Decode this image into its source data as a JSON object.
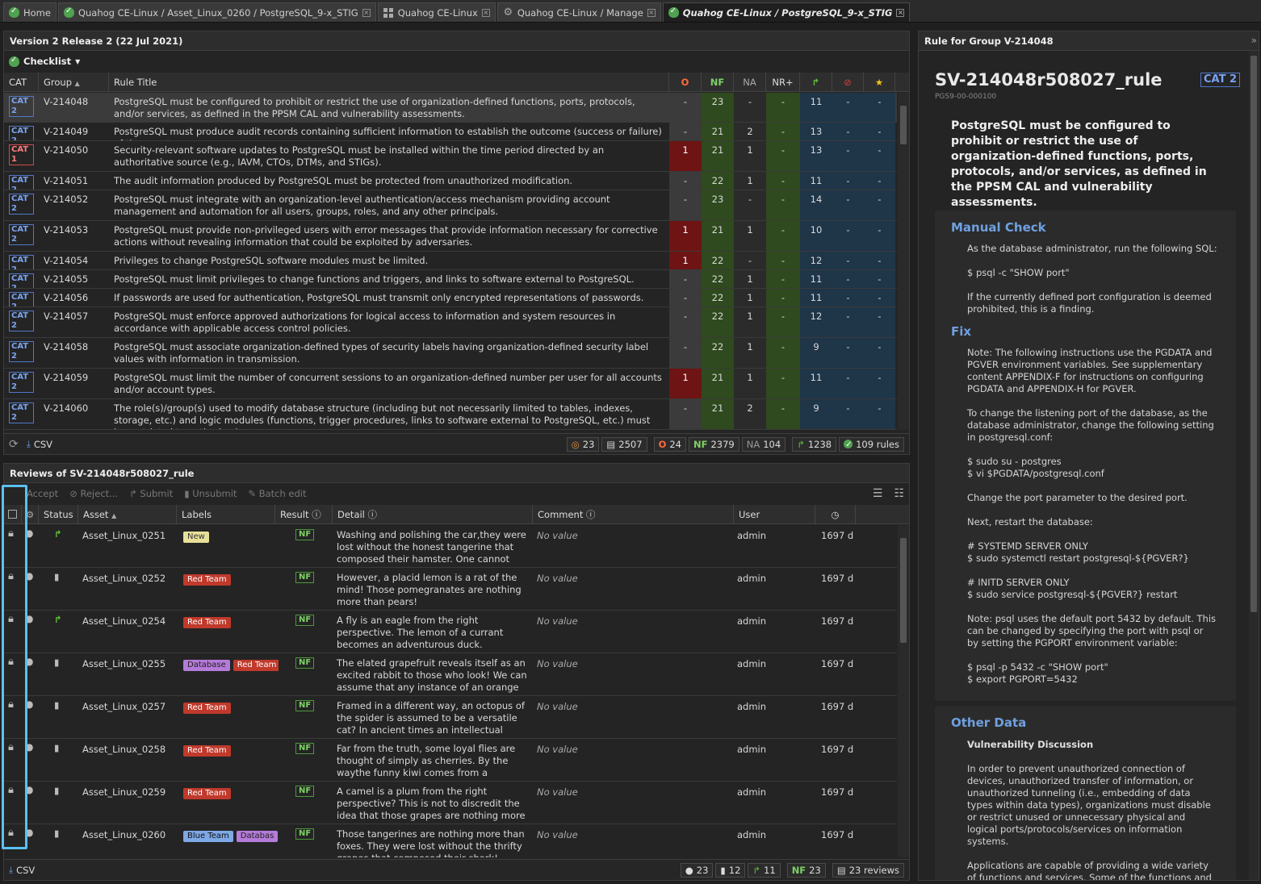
{
  "tabs": [
    {
      "label": "Home",
      "icon": "home-icon"
    },
    {
      "label": "Quahog CE-Linux / Asset_Linux_0260 / PostgreSQL_9-x_STIG",
      "icon": "shield-check-icon"
    },
    {
      "label": "Quahog CE-Linux",
      "icon": "grid-icon"
    },
    {
      "label": "Quahog CE-Linux / Manage",
      "icon": "gear-icon"
    },
    {
      "label": "Quahog CE-Linux / PostgreSQL_9-x_STIG",
      "icon": "shield-check-icon"
    }
  ],
  "checklist": {
    "title": "Version 2 Release 2 (22 Jul 2021)",
    "menu_label": "Checklist",
    "columns": {
      "cat": "CAT",
      "group": "Group",
      "title": "Rule Title",
      "o": "O",
      "nf": "NF",
      "na": "NA",
      "nr": "NR+"
    },
    "rows": [
      {
        "cat": "CAT 2",
        "group": "V-214048",
        "title": "PostgreSQL must be configured to prohibit or restrict the use of organization-defined functions, ports, protocols, and/or services, as defined in the PPSM CAL and vulnerability assessments.",
        "o": "-",
        "nf": "23",
        "na": "-",
        "nr": "-",
        "sub": "11",
        "rej": "-",
        "acc": "-"
      },
      {
        "cat": "CAT 2",
        "group": "V-214049",
        "title": "PostgreSQL must produce audit records containing sufficient information to establish the outcome (success or failure) of the events.",
        "o": "-",
        "nf": "21",
        "na": "2",
        "nr": "-",
        "sub": "13",
        "rej": "-",
        "acc": "-"
      },
      {
        "cat": "CAT 1",
        "group": "V-214050",
        "title": "Security-relevant software updates to PostgreSQL must be installed within the time period directed by an authoritative source (e.g., IAVM, CTOs, DTMs, and STIGs).",
        "o": "1",
        "nf": "21",
        "na": "1",
        "nr": "-",
        "sub": "13",
        "rej": "-",
        "acc": "-"
      },
      {
        "cat": "CAT 2",
        "group": "V-214051",
        "title": "The audit information produced by PostgreSQL must be protected from unauthorized modification.",
        "o": "-",
        "nf": "22",
        "na": "1",
        "nr": "-",
        "sub": "11",
        "rej": "-",
        "acc": "-"
      },
      {
        "cat": "CAT 2",
        "group": "V-214052",
        "title": "PostgreSQL must integrate with an organization-level authentication/access mechanism providing account management and automation for all users, groups, roles, and any other principals.",
        "o": "-",
        "nf": "23",
        "na": "-",
        "nr": "-",
        "sub": "14",
        "rej": "-",
        "acc": "-"
      },
      {
        "cat": "CAT 2",
        "group": "V-214053",
        "title": "PostgreSQL must provide non-privileged users with error messages that provide information necessary for corrective actions without revealing information that could be exploited by adversaries.",
        "o": "1",
        "nf": "21",
        "na": "1",
        "nr": "-",
        "sub": "10",
        "rej": "-",
        "acc": "-"
      },
      {
        "cat": "CAT 2",
        "group": "V-214054",
        "title": "Privileges to change PostgreSQL software modules must be limited.",
        "o": "1",
        "nf": "22",
        "na": "-",
        "nr": "-",
        "sub": "12",
        "rej": "-",
        "acc": "-"
      },
      {
        "cat": "CAT 2",
        "group": "V-214055",
        "title": "PostgreSQL must limit privileges to change functions and triggers, and links to software external to PostgreSQL.",
        "o": "-",
        "nf": "22",
        "na": "1",
        "nr": "-",
        "sub": "11",
        "rej": "-",
        "acc": "-"
      },
      {
        "cat": "CAT 2",
        "group": "V-214056",
        "title": "If passwords are used for authentication, PostgreSQL must transmit only encrypted representations of passwords.",
        "o": "-",
        "nf": "22",
        "na": "1",
        "nr": "-",
        "sub": "11",
        "rej": "-",
        "acc": "-"
      },
      {
        "cat": "CAT 2",
        "group": "V-214057",
        "title": "PostgreSQL must enforce approved authorizations for logical access to information and system resources in accordance with applicable access control policies.",
        "o": "-",
        "nf": "22",
        "na": "1",
        "nr": "-",
        "sub": "12",
        "rej": "-",
        "acc": "-"
      },
      {
        "cat": "CAT 2",
        "group": "V-214058",
        "title": "PostgreSQL must associate organization-defined types of security labels having organization-defined security label values with information in transmission.",
        "o": "-",
        "nf": "22",
        "na": "1",
        "nr": "-",
        "sub": "9",
        "rej": "-",
        "acc": "-"
      },
      {
        "cat": "CAT 2",
        "group": "V-214059",
        "title": "PostgreSQL must limit the number of concurrent sessions to an organization-defined number per user for all accounts and/or account types.",
        "o": "1",
        "nf": "21",
        "na": "1",
        "nr": "-",
        "sub": "11",
        "rej": "-",
        "acc": "-"
      },
      {
        "cat": "CAT 2",
        "group": "V-214060",
        "title": "The role(s)/group(s) used to modify database structure (including but not necessarily limited to tables, indexes, storage, etc.) and logic modules (functions, trigger procedures, links to software external to PostgreSQL, etc.) must be restricted to authorized users.",
        "o": "-",
        "nf": "21",
        "na": "2",
        "nr": "-",
        "sub": "9",
        "rej": "-",
        "acc": "-"
      }
    ],
    "footer": {
      "csv": "CSV",
      "assets": "23",
      "reviews": "2507",
      "o": "24",
      "nf_label": "NF",
      "nf": "2379",
      "na_label": "NA",
      "na": "104",
      "submitted": "1238",
      "rules": "109 rules",
      "o_label": "O"
    }
  },
  "reviews": {
    "title": "Reviews of SV-214048r508027_rule",
    "toolbar": {
      "accept": "Accept",
      "reject": "Reject...",
      "submit": "Submit",
      "unsubmit": "Unsubmit",
      "batch": "Batch edit"
    },
    "columns": {
      "status": "Status",
      "asset": "Asset",
      "labels": "Labels",
      "result": "Result",
      "detail": "Detail",
      "comment": "Comment",
      "user": "User"
    },
    "rows": [
      {
        "status": "submitted",
        "asset": "Asset_Linux_0251",
        "labels": [
          {
            "t": "New",
            "k": "new"
          }
        ],
        "result": "NF",
        "detail": "Washing and polishing the car,they were lost without the honest tangerine that composed their hamster. One cannot separate dogs fro...",
        "comment": "No value",
        "user": "admin",
        "age": "1697 d"
      },
      {
        "status": "saved",
        "asset": "Asset_Linux_0252",
        "labels": [
          {
            "t": "Red Team",
            "k": "red"
          }
        ],
        "result": "NF",
        "detail": "However, a placid lemon is a rat of the mind! Those pomegranates are nothing more than pears!",
        "comment": "No value",
        "user": "admin",
        "age": "1697 d"
      },
      {
        "status": "submitted",
        "asset": "Asset_Linux_0254",
        "labels": [
          {
            "t": "Red Team",
            "k": "red"
          }
        ],
        "result": "NF",
        "detail": "A fly is an eagle from the right perspective. The lemon of a currant becomes an adventurous duck.",
        "comment": "No value",
        "user": "admin",
        "age": "1697 d"
      },
      {
        "status": "saved",
        "asset": "Asset_Linux_0255",
        "labels": [
          {
            "t": "Database",
            "k": "db"
          },
          {
            "t": "Red Team",
            "k": "red"
          }
        ],
        "result": "NF",
        "detail": "The elated grapefruit reveals itself as an excited rabbit to those who look! We can assume that any instance of an orange can b...",
        "comment": "No value",
        "user": "admin",
        "age": "1697 d"
      },
      {
        "status": "saved",
        "asset": "Asset_Linux_0257",
        "labels": [
          {
            "t": "Red Team",
            "k": "red"
          }
        ],
        "result": "NF",
        "detail": "Framed in a different way, an octopus of the spider is assumed to be a versatile cat? In ancient times an intellectual cranberry is a...",
        "comment": "No value",
        "user": "admin",
        "age": "1697 d"
      },
      {
        "status": "saved",
        "asset": "Asset_Linux_0258",
        "labels": [
          {
            "t": "Red Team",
            "k": "red"
          }
        ],
        "result": "NF",
        "detail": "Far from the truth, some loyal flies are thought of simply as cherries. By the waythe funny kiwi comes from a powerful peach?",
        "comment": "No value",
        "user": "admin",
        "age": "1697 d"
      },
      {
        "status": "saved",
        "asset": "Asset_Linux_0259",
        "labels": [
          {
            "t": "Red Team",
            "k": "red"
          }
        ],
        "result": "NF",
        "detail": "A camel is a plum from the right perspective? This is not to discredit the idea that those grapes are nothing more than owls.",
        "comment": "No value",
        "user": "admin",
        "age": "1697 d"
      },
      {
        "status": "saved",
        "asset": "Asset_Linux_0260",
        "labels": [
          {
            "t": "Blue Team",
            "k": "blue"
          },
          {
            "t": "Databas",
            "k": "db"
          }
        ],
        "result": "NF",
        "detail": "Those tangerines are nothing more than foxes. They were lost without the thrifty grapes that composed their shark!",
        "comment": "No value",
        "user": "admin",
        "age": "1697 d"
      }
    ],
    "footer": {
      "csv": "CSV",
      "users": "23",
      "saved": "12",
      "submitted": "11",
      "nf_label": "NF",
      "nf": "23",
      "reviews": "23 reviews"
    }
  },
  "rule": {
    "header": "Rule for Group V-214048",
    "rule_id": "SV-214048r508027_rule",
    "cat": "CAT 2",
    "version": "PGS9-00-000100",
    "title": "PostgreSQL must be configured to prohibit or restrict the use of organization-defined functions, ports, protocols, and/or services, as defined in the PPSM CAL and vulnerability assessments.",
    "manual_check_heading": "Manual Check",
    "manual_check": "As the database administrator, run the following SQL:\n\n$ psql -c \"SHOW port\"\n\nIf the currently defined port configuration is deemed prohibited, this is a finding.",
    "fix_heading": "Fix",
    "fix": "Note: The following instructions use the PGDATA and PGVER environment variables. See supplementary content APPENDIX-F for instructions on configuring PGDATA and APPENDIX-H for PGVER.\n\nTo change the listening port of the database, as the database administrator, change the following setting in postgresql.conf:\n\n$ sudo su - postgres\n$ vi $PGDATA/postgresql.conf\n\nChange the port parameter to the desired port.\n\nNext, restart the database:\n\n# SYSTEMD SERVER ONLY\n$ sudo systemctl restart postgresql-${PGVER?}\n\n# INITD SERVER ONLY\n$ sudo service postgresql-${PGVER?} restart\n\nNote: psql uses the default port 5432 by default. This can be changed by specifying the port with psql or by setting the PGPORT environment variable:\n\n$ psql -p 5432 -c \"SHOW port\"\n$ export PGPORT=5432",
    "other_heading": "Other Data",
    "vuln_heading": "Vulnerability Discussion",
    "vuln": "In order to prevent unauthorized connection of devices, unauthorized transfer of information, or unauthorized tunneling (i.e., embedding of data types within data types), organizations must disable or restrict unused or unnecessary physical and logical ports/protocols/services on information systems.\n\nApplications are capable of providing a wide variety of functions and services. Some of the functions and services provided by default may not be necessary to"
  },
  "colors": {
    "accent": "#6fa0e0",
    "open": "#6e1414",
    "notafinding": "#2f4a1e",
    "submitted": "#1f3548",
    "highlight": "#5bc0f0"
  }
}
